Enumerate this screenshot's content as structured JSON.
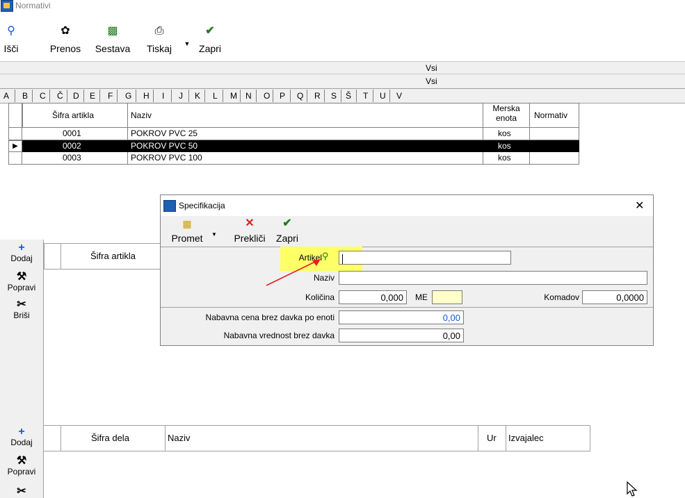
{
  "window": {
    "title": "Normativi"
  },
  "toolbar": {
    "search_label": "Išči",
    "transfer_label": "Prenos",
    "assembly_label": "Sestava",
    "print_label": "Tiskaj",
    "close_label": "Zapri"
  },
  "filters": {
    "row1": "Vsi",
    "row2": "Vsi"
  },
  "alphabet": [
    "A",
    "B",
    "C",
    "Č",
    "D",
    "E",
    "F",
    "G",
    "H",
    "I",
    "J",
    "K",
    "L",
    "M",
    "N",
    "O",
    "P",
    "Q",
    "R",
    "S",
    "Š",
    "T",
    "U",
    "V"
  ],
  "main_table": {
    "headers": {
      "code": "Šifra artikla",
      "name": "Naziv",
      "unit_line1": "Merska",
      "unit_line2": "enota",
      "norm": "Normativ"
    },
    "rows": [
      {
        "code": "0001",
        "name": "POKROV PVC 25",
        "unit": "kos",
        "norm": ""
      },
      {
        "code": "0002",
        "name": "POKROV PVC 50",
        "unit": "kos",
        "norm": ""
      },
      {
        "code": "0003",
        "name": "POKROV PVC 100",
        "unit": "kos",
        "norm": ""
      }
    ]
  },
  "side_buttons": {
    "add": "Dodaj",
    "edit": "Popravi",
    "delete": "Briši"
  },
  "middle_table": {
    "code_header": "Šifra artikla"
  },
  "lower_table": {
    "code_header": "Šifra dela",
    "name_header": "Naziv",
    "hours_header": "Ur",
    "performer_header": "Izvajalec"
  },
  "lower_buttons": {
    "add": "Dodaj",
    "edit": "Popravi"
  },
  "dialog": {
    "title": "Specifikacija",
    "toolbar": {
      "traffic_label": "Promet",
      "cancel_label": "Prekliči",
      "close_label": "Zapri"
    },
    "fields": {
      "article_label": "Artikel",
      "article_value": "",
      "name_label": "Naziv",
      "name_value": "",
      "quantity_label": "Količina",
      "quantity_value": "0,000",
      "unit_label": "ME",
      "unit_value": "",
      "pieces_label": "Komadov",
      "pieces_value": "0,0000",
      "unit_price_label": "Nabavna cena brez davka po enoti",
      "unit_price_value": "0,00",
      "value_label": "Nabavna vrednost brez davka",
      "value_value": "0,00"
    }
  },
  "colors": {
    "highlight": "#ffff66",
    "accent_blue": "#1a56db",
    "cancel_red": "#e02020",
    "check_green": "#1f7a1f"
  }
}
